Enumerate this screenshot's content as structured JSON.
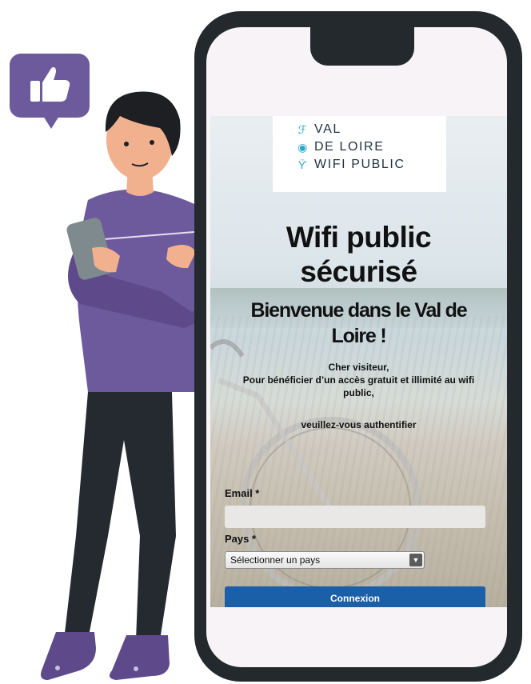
{
  "logo": {
    "line1": "VAL",
    "line2": "DE LOIRE",
    "line3": "WIFI PUBLIC",
    "icons": [
      "leaf-icon",
      "wifi-icon",
      "antenna-icon"
    ]
  },
  "page": {
    "title_line1": "Wifi public",
    "title_line2": "sécurisé",
    "subtitle_line1": "Bienvenue dans le Val de",
    "subtitle_line2": "Loire !",
    "intro_line1": "Cher visiteur,",
    "intro_line2": "Pour bénéficier d’un accès gratuit et illimité au wifi",
    "intro_line3": "public,",
    "auth_text": "veuillez-vous authentifier"
  },
  "form": {
    "email_label": "Email *",
    "email_value": "",
    "country_label": "Pays *",
    "country_selected": "Sélectionner un pays",
    "submit_label": "Connexion"
  },
  "colors": {
    "accent": "#6d5a9c",
    "button": "#1a5fa8",
    "phone_frame": "#23292c"
  }
}
